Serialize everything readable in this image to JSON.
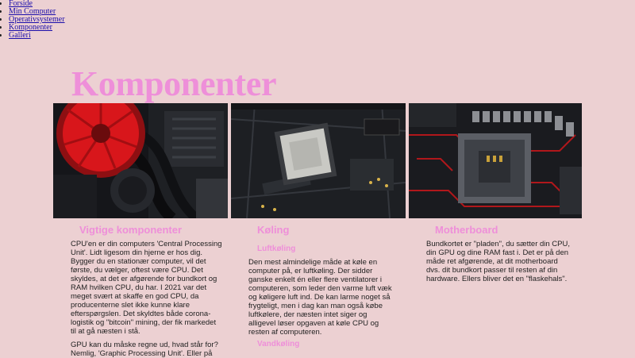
{
  "nav": {
    "items": [
      "Forside",
      "Min Computer",
      "Operativsystemer",
      "Komponenter",
      "Galleri"
    ]
  },
  "page": {
    "title": "Komponenter"
  },
  "images": [
    {
      "subject": "red-cpu-cooler-fan"
    },
    {
      "subject": "ryzen-cpu-on-motherboard"
    },
    {
      "subject": "motherboard-socket"
    }
  ],
  "columns": [
    {
      "heading": "Vigtige komponenter",
      "paragraphs": [
        "CPU'en er din computers 'Central Processing Unit'. Lidt ligesom din hjerne er hos dig. Bygger du en stationær computer, vil det første, du vælger, oftest være CPU. Det skyldes, at det er afgørende for bundkort og RAM hvilken CPU, du har. I 2021 var det meget svært at skaffe en god CPU, da producenterne slet ikke kunne klare efterspørgslen. Det skyldtes både corona-logistik og \"bitcoin\" mining, der fik markedet til at gå næsten i stå.",
        "GPU kan du måske regne ud, hvad står for? Nemlig, 'Graphic Processing Unit'. Eller på"
      ]
    },
    {
      "heading": "Køling",
      "subheadings": [
        "Luftkøling",
        "Vandkøling"
      ],
      "paragraphs": [
        "Den mest almindelige måde at køle en computer på, er luftkøling. Der sidder ganske enkelt én eller flere ventilatorer i computeren, som leder den varme luft væk og køligere luft ind. De kan larme noget så frygteligt, men i dag kan man også købe luftkølere, der næsten intet siger og alligevel løser opgaven at køle CPU og resten af computeren."
      ]
    },
    {
      "heading": "Motherboard",
      "paragraphs": [
        "Bundkortet er \"pladen\", du sætter din CPU, din GPU og dine RAM fast i. Det er på den måde ret afgørende, at dit motherboard dvs. dit bundkort passer til resten af din hardware. Ellers bliver det en \"flaskehals\"."
      ]
    }
  ]
}
